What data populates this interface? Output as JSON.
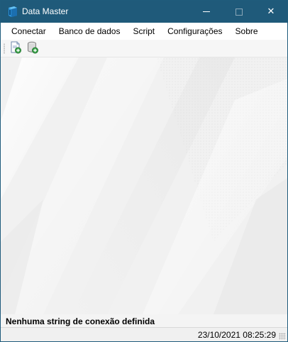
{
  "window": {
    "title": "Data Master",
    "app_icon": "database-app-icon",
    "controls": {
      "minimize_icon": "minimize-icon",
      "maximize_icon": "maximize-icon",
      "close_icon": "close-icon",
      "close_glyph": "✕"
    }
  },
  "menu": {
    "items": [
      {
        "label": "Conectar"
      },
      {
        "label": "Banco de dados"
      },
      {
        "label": "Script"
      },
      {
        "label": "Configurações"
      },
      {
        "label": "Sobre"
      }
    ]
  },
  "toolbar": {
    "buttons": [
      {
        "icon": "new-connection-icon"
      },
      {
        "icon": "add-database-icon"
      }
    ]
  },
  "status": {
    "connection_message": "Nenhuma string de conexão definida",
    "datetime": "23/10/2021 08:25:29"
  },
  "colors": {
    "titlebar": "#1f5a7a",
    "accent_green": "#3aa14a",
    "background": "#f2f2f2"
  }
}
